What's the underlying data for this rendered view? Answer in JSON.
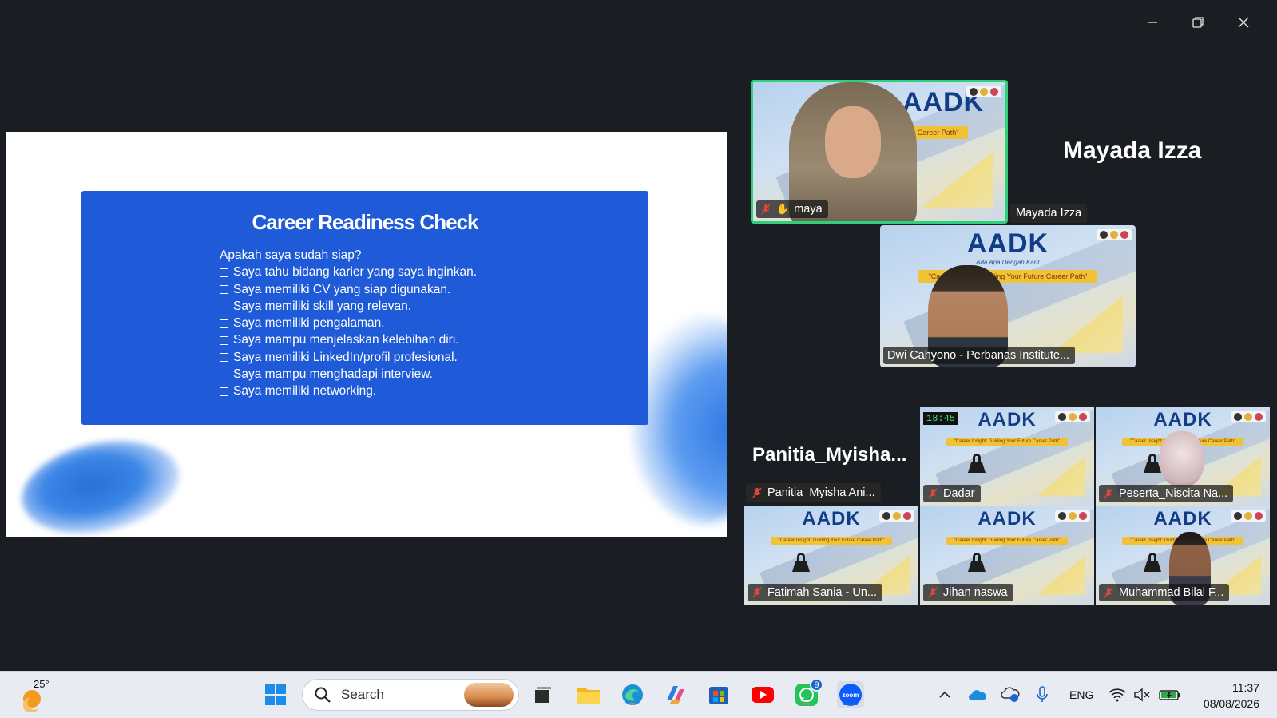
{
  "window": {
    "minimize": "minimize",
    "restore": "restore",
    "close": "close"
  },
  "slide": {
    "title": "Career Readiness Check",
    "question": "Apakah saya sudah siap?",
    "items": [
      "Saya tahu bidang karier yang saya inginkan.",
      "Saya memiliki CV yang siap digunakan.",
      "Saya memiliki skill yang relevan.",
      "Saya memiliki pengalaman.",
      "Saya mampu menjelaskan kelebihan diri.",
      "Saya memiliki LinkedIn/profil profesional.",
      "Saya mampu menghadapi interview.",
      "Saya memiliki networking."
    ]
  },
  "tile_brand": {
    "logo": "AADK",
    "subtitle": "Ada Apa Dengan Karir",
    "banner": "\"Career Insight: Guiding Your Future Career Path\""
  },
  "speakers": {
    "active": {
      "name": "maya",
      "label": "Mayada Izza",
      "big_name": "Mayada Izza"
    },
    "second": {
      "name": "Dwi Cahyono - Perbanas Institute..."
    }
  },
  "gallery": {
    "big_name": "Panitia_Myisha...",
    "timer": "18:45",
    "participants": [
      "Panitia_Myisha Ani...",
      "Dadar",
      "Peserta_Niscita Na...",
      "Fatimah Sania - Un...",
      "Jihan naswa",
      "Muhammad Bilal F..."
    ]
  },
  "taskbar": {
    "temperature": "25°",
    "search_label": "Search",
    "whatsapp_badge": "9",
    "zoom_label": "zoom",
    "language": "ENG",
    "time": "11:37",
    "date": "08/08/2026"
  },
  "colors": {
    "card_blue": "#1f5bd8",
    "active_border": "#2fd07a",
    "muted_red": "#e0453a",
    "taskbar_bg": "#e8ecf2",
    "accent": "#1a66d1"
  }
}
